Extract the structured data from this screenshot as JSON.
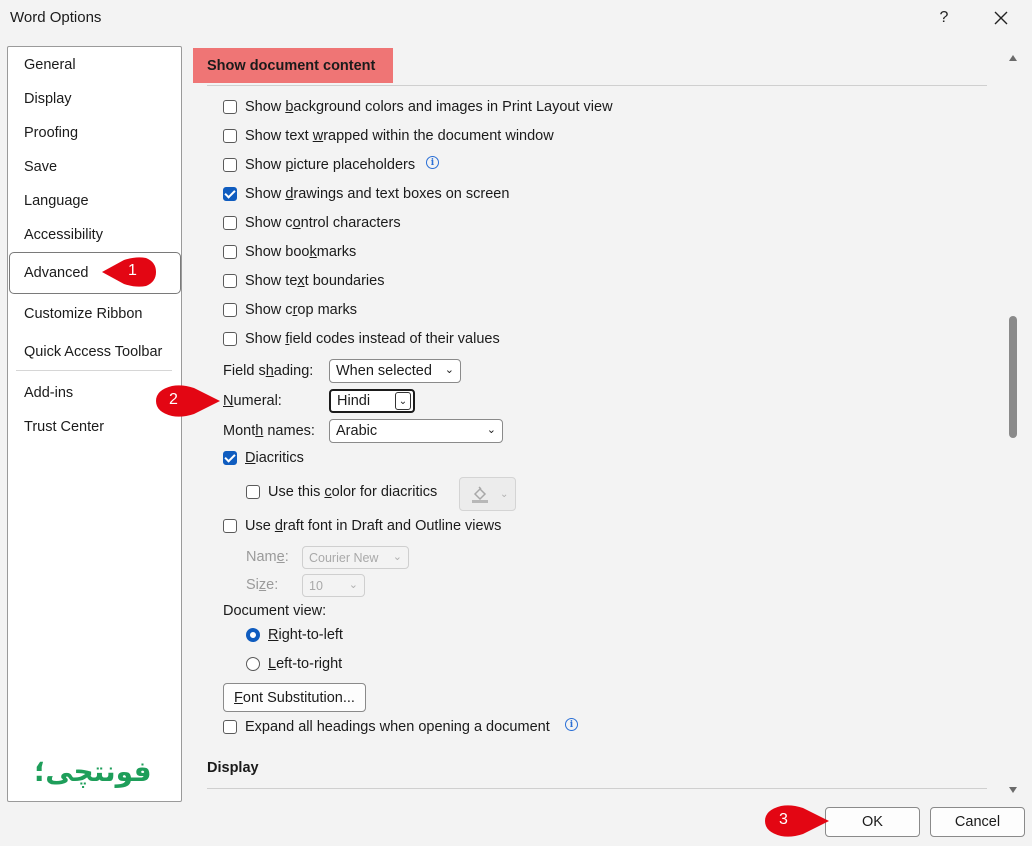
{
  "window": {
    "title": "Word Options",
    "help": "?",
    "close": "✕"
  },
  "sidebar": {
    "items": [
      "General",
      "Display",
      "Proofing",
      "Save",
      "Language",
      "Accessibility",
      "Advanced",
      "Customize Ribbon",
      "Quick Access Toolbar",
      "Add-ins",
      "Trust Center"
    ],
    "active": "Advanced",
    "logo_text": "فونتچی؛"
  },
  "section": {
    "header": "Show document content",
    "next_header": "Display"
  },
  "options": [
    {
      "pre": "Show ",
      "ul": "b",
      "post": "ackground colors and images in Print Layout view",
      "checked": false,
      "info": false
    },
    {
      "pre": "Show text ",
      "ul": "w",
      "post": "rapped within the document window",
      "checked": false,
      "info": false
    },
    {
      "pre": "Show ",
      "ul": "p",
      "post": "icture placeholders",
      "checked": false,
      "info": true
    },
    {
      "pre": "Show ",
      "ul": "d",
      "post": "rawings and text boxes on screen",
      "checked": true,
      "info": false
    },
    {
      "pre": "Show c",
      "ul": "o",
      "post": "ntrol characters",
      "checked": false,
      "info": false
    },
    {
      "pre": "Show boo",
      "ul": "k",
      "post": "marks",
      "checked": false,
      "info": false
    },
    {
      "pre": "Show te",
      "ul": "x",
      "post": "t boundaries",
      "checked": false,
      "info": false
    },
    {
      "pre": "Show c",
      "ul": "r",
      "post": "op marks",
      "checked": false,
      "info": false
    },
    {
      "pre": "Show ",
      "ul": "f",
      "post": "ield codes instead of their values",
      "checked": false,
      "info": false
    }
  ],
  "field_shading": {
    "pre": "Field s",
    "ul": "h",
    "post": "ading:",
    "value": "When selected"
  },
  "numeral": {
    "pre": "",
    "ul": "N",
    "post": "umeral:",
    "value": "Hindi"
  },
  "month_names": {
    "pre": "Mont",
    "ul": "h",
    "post": " names:",
    "value": "Arabic"
  },
  "diacritics": {
    "pre": "",
    "ul": "D",
    "post": "iacritics",
    "checked": true
  },
  "diacritics_color": {
    "pre": "Use this ",
    "ul": "c",
    "post": "olor for diacritics",
    "checked": false
  },
  "draft_font": {
    "pre": "Use ",
    "ul": "d",
    "post": "raft font in Draft and Outline views",
    "checked": false
  },
  "draft_name": {
    "pre": "Nam",
    "ul": "e",
    "post": ":",
    "value": "Courier New"
  },
  "draft_size": {
    "pre": "Si",
    "ul": "z",
    "post": "e:",
    "value": "10"
  },
  "document_view": {
    "label": "Document view:",
    "rtl": {
      "pre": "",
      "ul": "R",
      "post": "ight-to-left",
      "selected": true
    },
    "ltr": {
      "pre": "",
      "ul": "L",
      "post": "eft-to-right",
      "selected": false
    }
  },
  "font_sub": {
    "pre": "",
    "ul": "F",
    "post": "ont Substitution...",
    "value": ""
  },
  "expand_headings": {
    "label": "Expand all headings when opening a document",
    "checked": false
  },
  "footer": {
    "ok": "OK",
    "cancel": "Cancel"
  },
  "badges": [
    "1",
    "2",
    "3"
  ],
  "colors": {
    "accent": "#0f5cbf",
    "header_highlight": "#ef7575",
    "badge_red": "#e30613",
    "logo_green": "#1e9e5a"
  }
}
